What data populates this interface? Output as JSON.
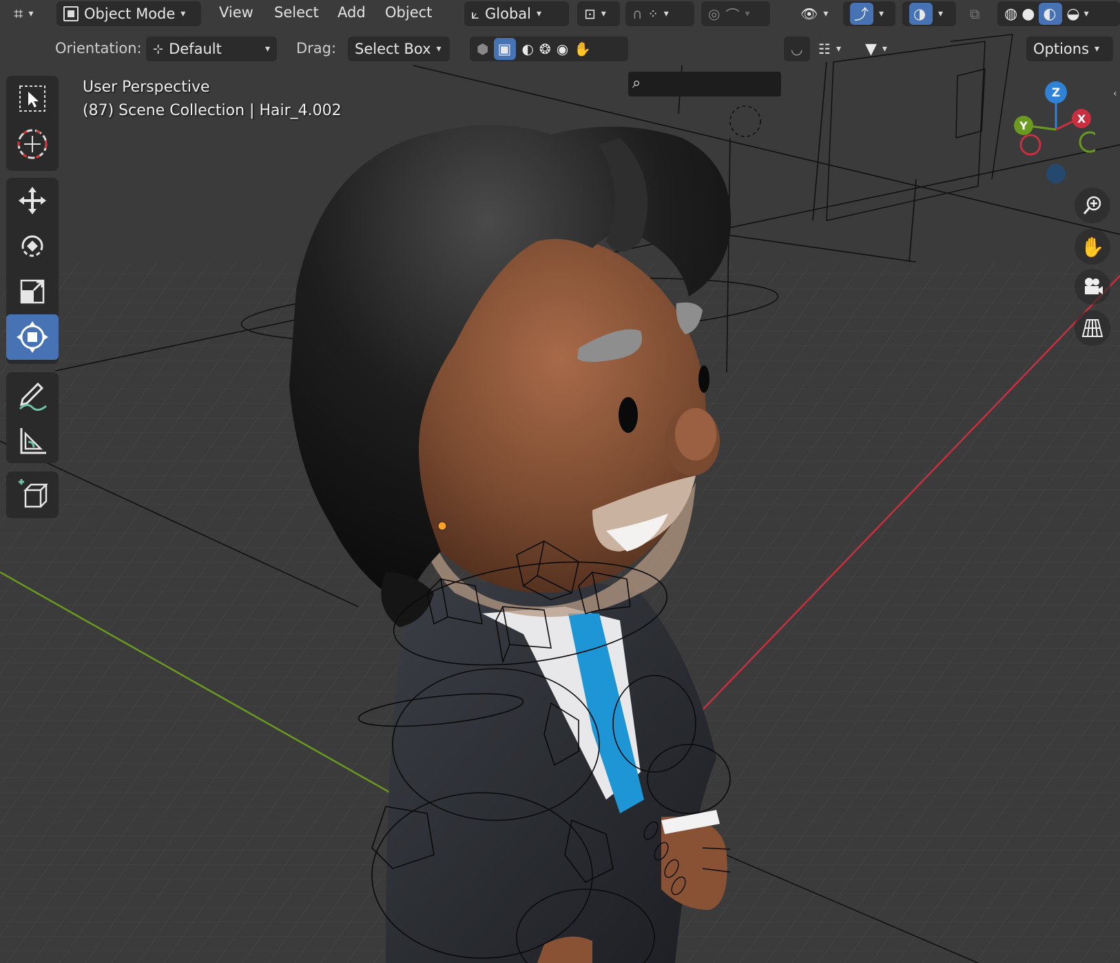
{
  "header": {
    "mode": "Object Mode",
    "menus": [
      "View",
      "Select",
      "Add",
      "Object"
    ],
    "transform_orientation": "Global",
    "options_label": "Options"
  },
  "tool_settings": {
    "orientation_label": "Orientation:",
    "orientation_value": "Default",
    "drag_label": "Drag:",
    "drag_value": "Select Box"
  },
  "viewport": {
    "perspective": "User Perspective",
    "object_info": "(87) Scene Collection | Hair_4.002"
  },
  "gizmo": {
    "z": "Z",
    "y": "Y",
    "x": "X"
  },
  "colors": {
    "accent": "#4772b3",
    "header_bg": "#2b2b2b",
    "viewport_bg": "#3b3b3b",
    "x_axis": "#c8303f",
    "y_axis": "#6a9a1f",
    "z_axis": "#2f82d6"
  },
  "toolbar_icons": [
    "select-box-icon",
    "cursor-icon",
    "move-icon",
    "rotate-icon",
    "scale-icon",
    "transform-icon",
    "annotate-icon",
    "measure-icon",
    "add-cube-icon"
  ],
  "nav_icons": [
    "zoom-icon",
    "pan-hand-icon",
    "camera-icon",
    "grid-perspective-icon"
  ]
}
